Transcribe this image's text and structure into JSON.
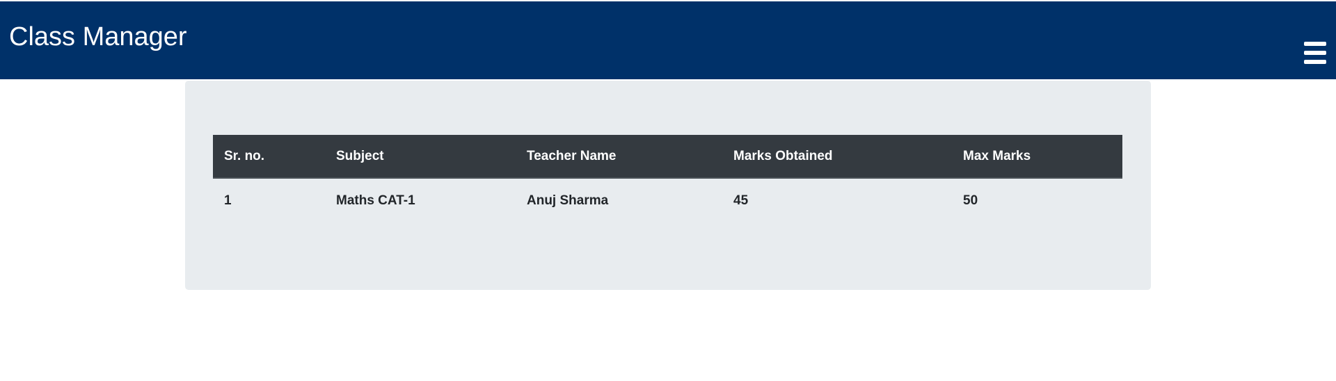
{
  "app": {
    "brand": "Class Manager",
    "menu_icon": "hamburger-menu-icon"
  },
  "colors": {
    "navbar_bg": "#003169",
    "panel_bg": "#e8ecef",
    "table_header_bg": "#343a40"
  },
  "table": {
    "headers": [
      "Sr. no.",
      "Subject",
      "Teacher Name",
      "Marks Obtained",
      "Max Marks"
    ],
    "rows": [
      [
        "1",
        "Maths CAT-1",
        "Anuj Sharma",
        "45",
        "50"
      ]
    ]
  }
}
